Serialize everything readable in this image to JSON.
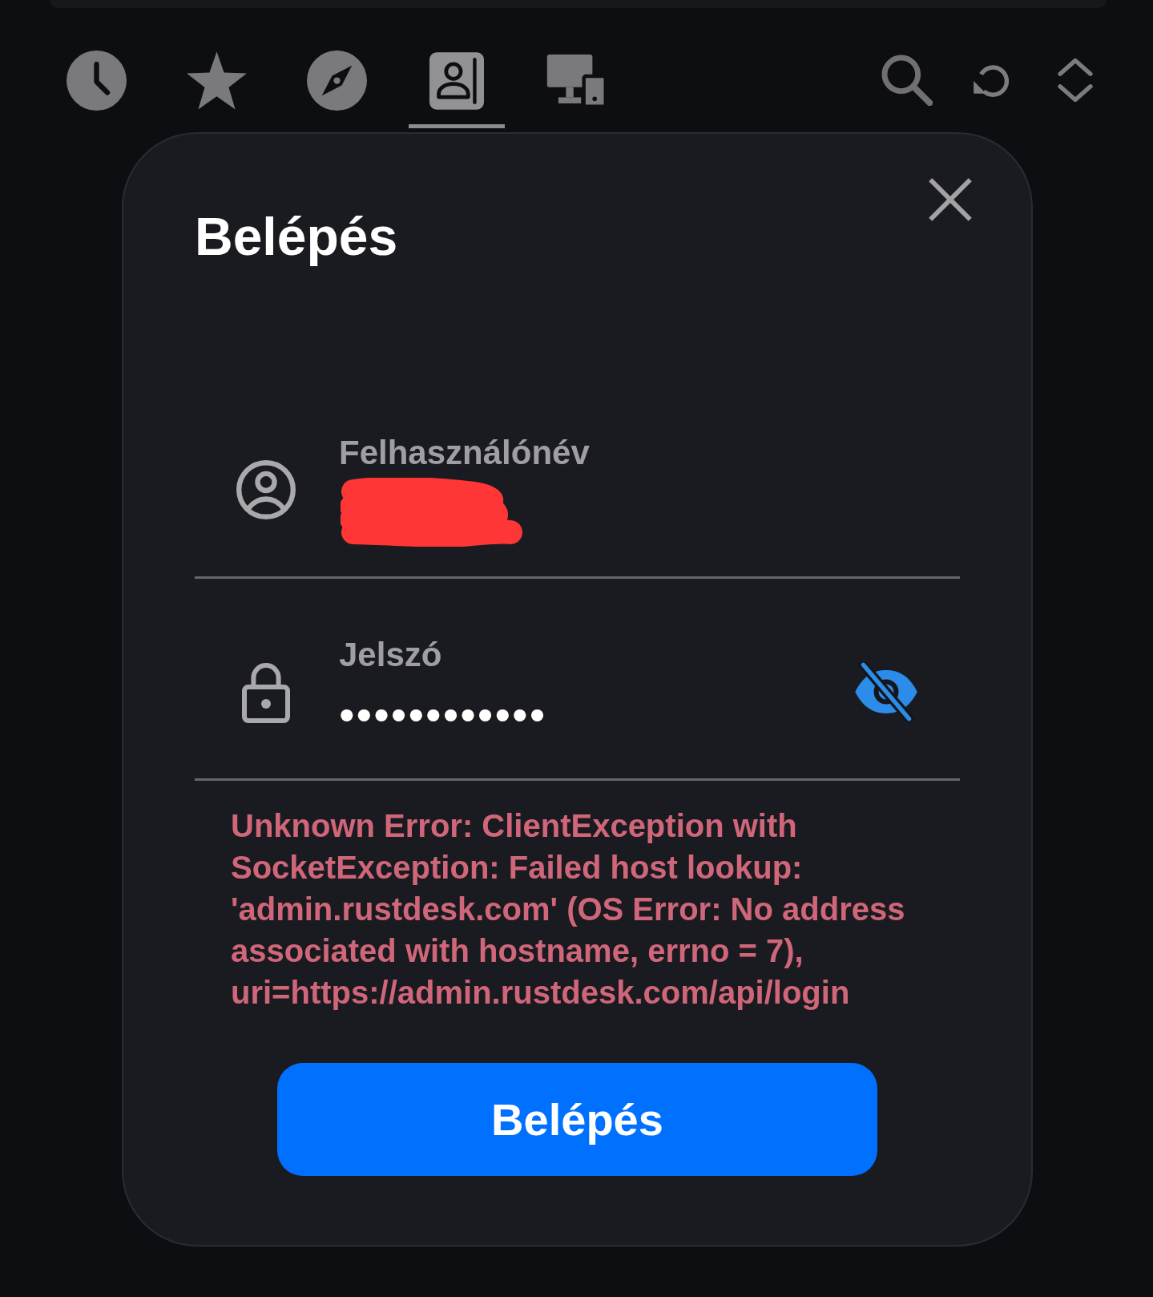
{
  "tabs": [
    {
      "selected": false
    },
    {
      "selected": false
    },
    {
      "selected": false
    },
    {
      "selected": true
    },
    {
      "selected": false
    }
  ],
  "dialog": {
    "title": "Belépés",
    "username_field": {
      "label": "Felhasználónév",
      "redacted": true
    },
    "password_field": {
      "label": "Jelszó",
      "value": "••••••••••••",
      "visible": false
    },
    "error": "Unknown Error: ClientException with SocketException: Failed host lookup: 'admin.rustdesk.com' (OS Error: No address associated with hostname, errno = 7), uri=https://admin.rustdesk.com/api/login",
    "submit_button": "Belépés"
  }
}
